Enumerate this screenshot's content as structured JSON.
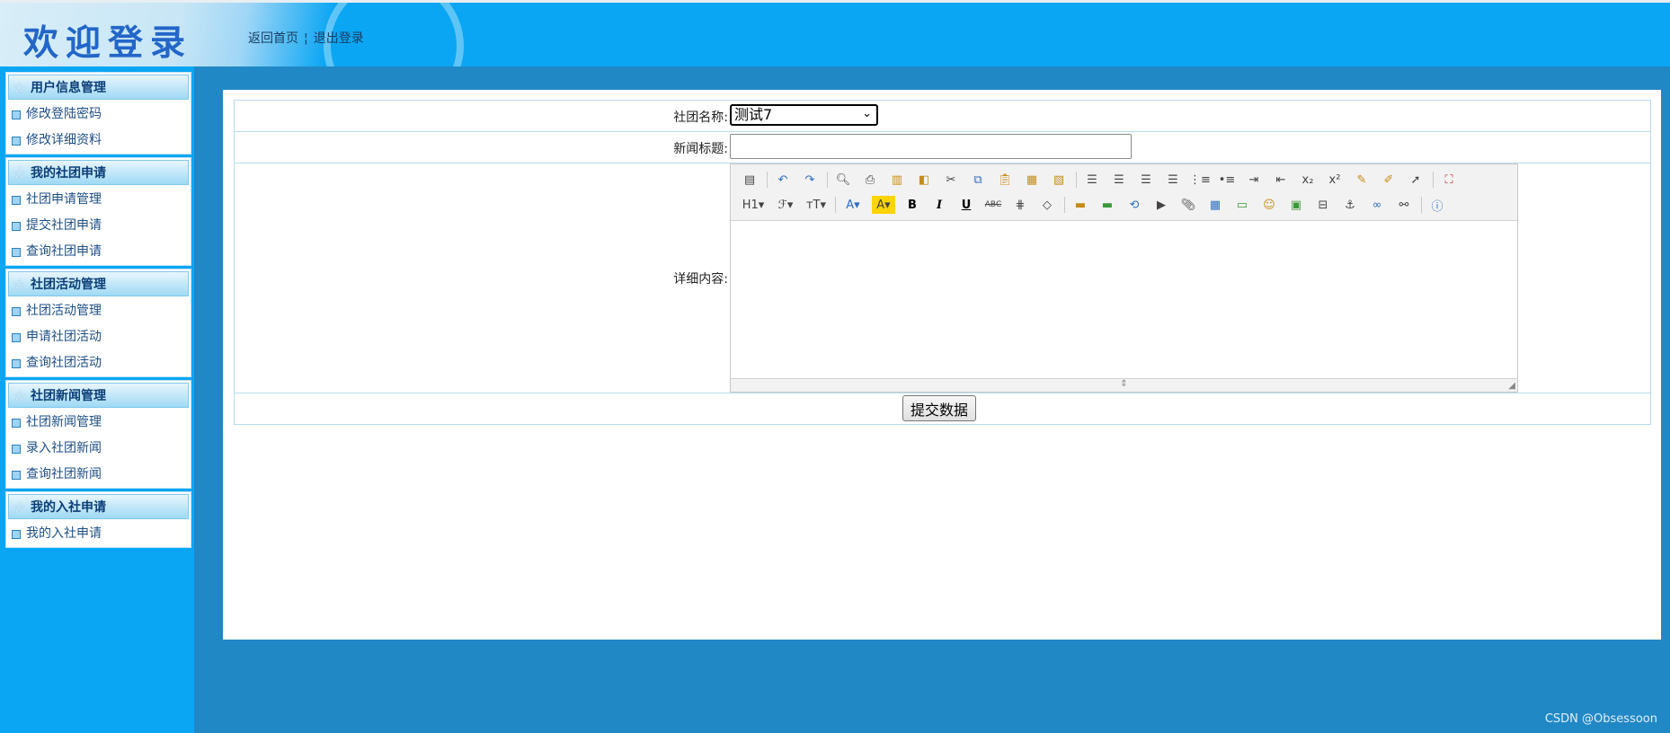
{
  "header": {
    "title": "欢迎登录",
    "links": [
      {
        "label": "返回首页"
      },
      {
        "label": "退出登录"
      }
    ]
  },
  "sidebar": {
    "groups": [
      {
        "title": "用户信息管理",
        "items": [
          "修改登陆密码",
          "修改详细资料"
        ]
      },
      {
        "title": "我的社团申请",
        "items": [
          "社团申请管理",
          "提交社团申请",
          "查询社团申请"
        ]
      },
      {
        "title": "社团活动管理",
        "items": [
          "社团活动管理",
          "申请社团活动",
          "查询社团活动"
        ]
      },
      {
        "title": "社团新闻管理",
        "items": [
          "社团新闻管理",
          "录入社团新闻",
          "查询社团新闻"
        ]
      },
      {
        "title": "我的入社申请",
        "items": [
          "我的入社申请"
        ]
      }
    ]
  },
  "form": {
    "club_label": "社团名称:",
    "club_selected": "测试7",
    "news_title_label": "新闻标题:",
    "news_title_value": "",
    "detail_label": "详细内容:",
    "submit_label": "提交数据"
  },
  "editor": {
    "toolbar_row1": [
      "source-icon",
      "|",
      "undo-icon",
      "redo-icon",
      "|",
      "preview-icon",
      "print-icon",
      "template-icon",
      "code-icon",
      "cut-icon",
      "copy-icon",
      "paste-icon",
      "paste-text-icon",
      "paste-word-icon",
      "|",
      "align-left-icon",
      "align-center-icon",
      "align-right-icon",
      "align-justify-icon",
      "ordered-list-icon",
      "unordered-list-icon",
      "indent-icon",
      "outdent-icon",
      "subscript-icon",
      "superscript-icon",
      "clear-format-icon",
      "select-all-icon",
      "pointer-icon",
      "|",
      "fullscreen-icon"
    ],
    "toolbar_row2": [
      "heading-icon",
      "font-family-icon",
      "font-size-icon",
      "|",
      "font-color-icon",
      "highlight-icon",
      "bold-icon",
      "italic-icon",
      "underline-icon",
      "strikethrough-icon",
      "line-height-icon",
      "eraser-icon",
      "|",
      "image-icon",
      "multi-image-icon",
      "flash-icon",
      "media-icon",
      "attachment-icon",
      "table-icon",
      "hr-icon",
      "emoticon-icon",
      "map-icon",
      "pagebreak-icon",
      "anchor-icon",
      "link-icon",
      "unlink-icon",
      "|",
      "about-icon"
    ]
  },
  "watermark": "CSDN @Obsessoon"
}
